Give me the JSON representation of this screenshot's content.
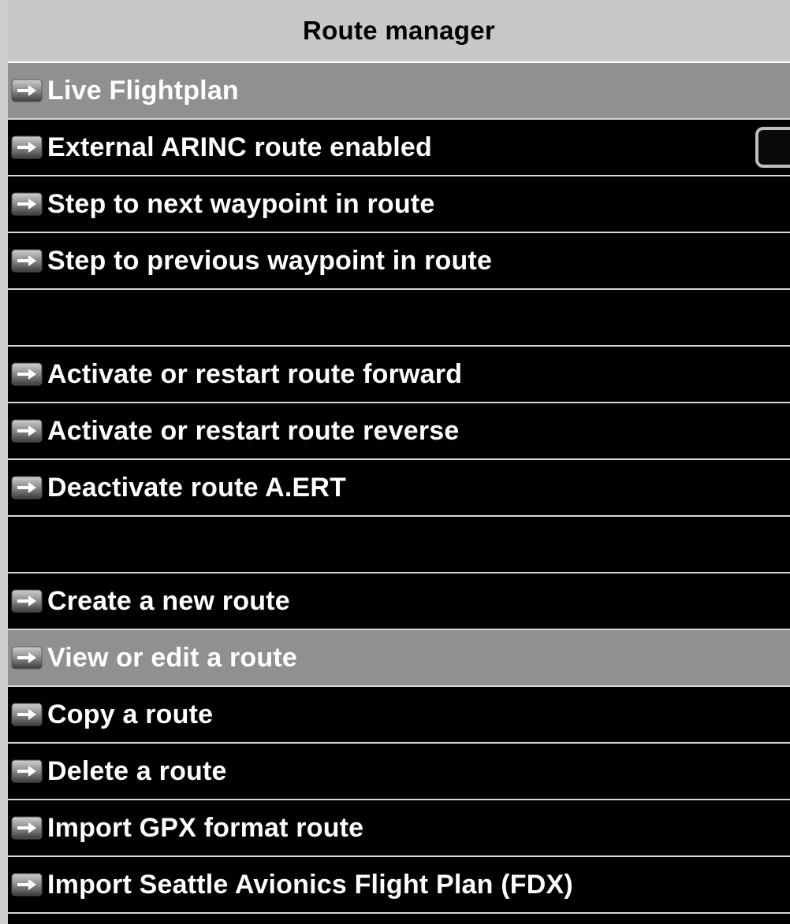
{
  "header": {
    "title": "Route manager"
  },
  "menu": {
    "items": [
      {
        "label": "Live Flightplan",
        "icon": "arrow-right-icon",
        "highlighted": true
      },
      {
        "label": "External ARINC route enabled",
        "icon": "arrow-right-icon",
        "checkbox": false
      },
      {
        "label": "Step to next waypoint in route",
        "icon": "arrow-right-icon"
      },
      {
        "label": "Step to previous waypoint in route",
        "icon": "arrow-right-icon"
      },
      {
        "label": "Activate or restart route forward",
        "icon": "arrow-right-icon"
      },
      {
        "label": "Activate or restart route reverse",
        "icon": "arrow-right-icon"
      },
      {
        "label": "Deactivate route A.ERT",
        "icon": "arrow-right-icon"
      },
      {
        "label": "Create a new route",
        "icon": "arrow-right-icon"
      },
      {
        "label": "View or edit a route",
        "icon": "arrow-right-icon",
        "highlighted": true
      },
      {
        "label": "Copy a route",
        "icon": "arrow-right-icon"
      },
      {
        "label": "Delete a route",
        "icon": "arrow-right-icon"
      },
      {
        "label": "Import GPX format route",
        "icon": "arrow-right-icon"
      },
      {
        "label": "Import Seattle Avionics Flight Plan (FDX)",
        "icon": "arrow-right-icon"
      }
    ]
  },
  "colors": {
    "background": "#000000",
    "title_bar": "#c8c8c8",
    "highlight": "#909090",
    "divider": "#d8d8d8",
    "text": "#ffffff"
  }
}
